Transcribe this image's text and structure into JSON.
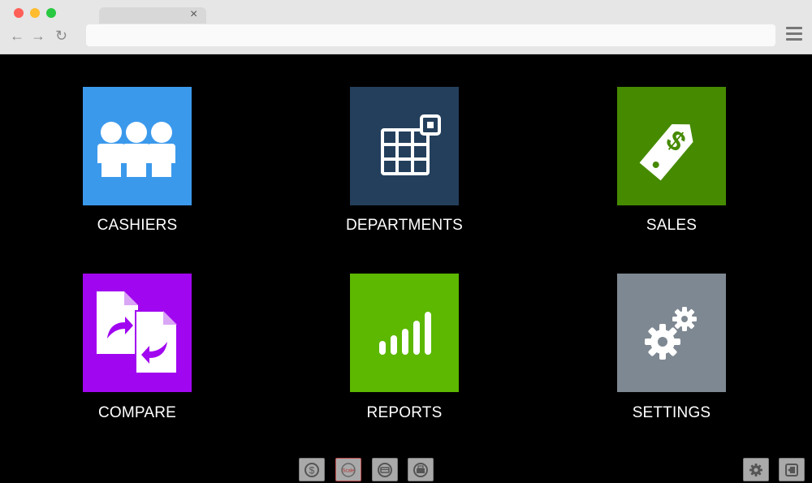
{
  "browser": {
    "traffic_lights": [
      "close",
      "minimize",
      "maximize"
    ],
    "tab_close": "×",
    "address_value": "",
    "nav": {
      "back": "←",
      "forward": "→",
      "reload": "↻"
    },
    "menu_icon": "hamburger-menu-icon"
  },
  "tiles": [
    {
      "id": "cashiers",
      "label": "CASHIERS",
      "color": "#3b99ec",
      "icon": "people-icon"
    },
    {
      "id": "departments",
      "label": "DEPARTMENTS",
      "color": "#243f5c",
      "icon": "grid-icon"
    },
    {
      "id": "sales",
      "label": "SALES",
      "color": "#468a00",
      "icon": "price-tag-icon"
    },
    {
      "id": "compare",
      "label": "COMPARE",
      "color": "#a106f0",
      "icon": "compare-documents-icon"
    },
    {
      "id": "reports",
      "label": "REPORTS",
      "color": "#5cb800",
      "icon": "bar-signal-icon"
    },
    {
      "id": "settings",
      "label": "SETTINGS",
      "color": "#7e8892",
      "icon": "gears-icon"
    }
  ],
  "bottom_toolbar": [
    {
      "id": "money",
      "icon": "dollar-coin-icon"
    },
    {
      "id": "scale",
      "icon": "scale-icon",
      "text": "Scale"
    },
    {
      "id": "card",
      "icon": "card-icon"
    },
    {
      "id": "printer",
      "icon": "printer-icon"
    }
  ],
  "bottom_right": [
    {
      "id": "gear",
      "icon": "gear-icon"
    },
    {
      "id": "exit",
      "icon": "exit-icon"
    }
  ]
}
